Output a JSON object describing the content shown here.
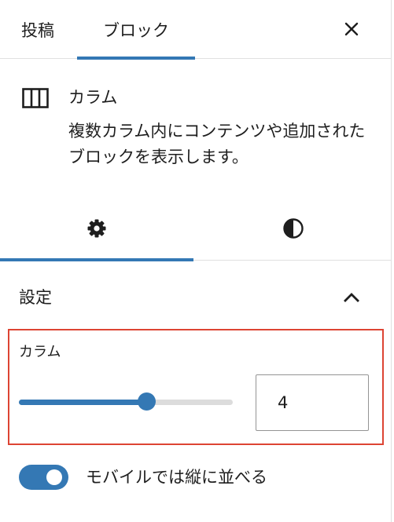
{
  "header": {
    "tabs": [
      {
        "label": "投稿"
      },
      {
        "label": "ブロック"
      }
    ],
    "close_icon": "close-icon"
  },
  "block": {
    "icon": "columns-icon",
    "title": "カラム",
    "description": "複数カラム内にコンテンツや追加されたブロックを表示します。"
  },
  "inspector_tabs": [
    {
      "icon": "gear-icon",
      "active": true
    },
    {
      "icon": "contrast-icon",
      "active": false
    }
  ],
  "settings": {
    "title": "設定",
    "expanded": true,
    "columns": {
      "label": "カラム",
      "value": "4",
      "slider_fraction": 0.6
    },
    "stack_on_mobile": {
      "label": "モバイルでは縦に並べる",
      "on": true
    }
  },
  "colors": {
    "accent": "#3478b4",
    "highlight": "#dd4433"
  }
}
